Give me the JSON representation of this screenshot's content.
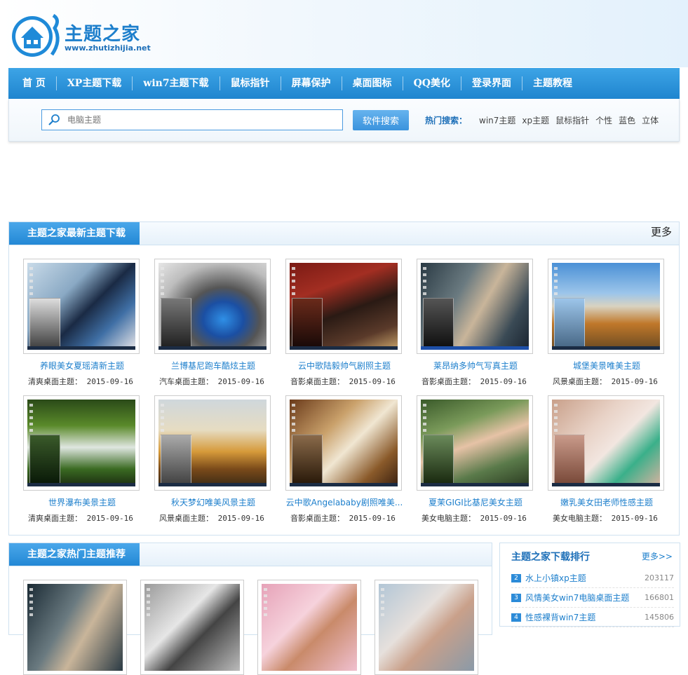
{
  "header": {
    "logo_title": "主题之家",
    "logo_url": "www.zhutizhijia.net"
  },
  "nav": [
    "首 页",
    "XP主题下载",
    "win7主题下载",
    "鼠标指针",
    "屏幕保护",
    "桌面图标",
    "QQ美化",
    "登录界面",
    "主题教程"
  ],
  "search": {
    "placeholder": "电脑主题",
    "button": "软件搜索",
    "hot_label": "热门搜索：",
    "hot_links": [
      "win7主题",
      "xp主题",
      "鼠标指针",
      "个性",
      "蓝色",
      "立体"
    ]
  },
  "latest": {
    "title": "主题之家最新主题下载",
    "more": "更多",
    "items": [
      {
        "title": "养眼美女夏瑶清新主题",
        "category": "清爽桌面主题：",
        "date": "2015-09-16"
      },
      {
        "title": "兰博基尼跑车酷炫主题",
        "category": "汽车桌面主题：",
        "date": "2015-09-16"
      },
      {
        "title": "云中歌陆毅帅气剧照主题",
        "category": "音影桌面主题：",
        "date": "2015-09-16"
      },
      {
        "title": "莱昂纳多帅气写真主题",
        "category": "音影桌面主题：",
        "date": "2015-09-16"
      },
      {
        "title": "城堡美景唯美主题",
        "category": "风景桌面主题：",
        "date": "2015-09-16"
      },
      {
        "title": "世界瀑布美景主题",
        "category": "清爽桌面主题：",
        "date": "2015-09-16"
      },
      {
        "title": "秋天梦幻唯美风景主题",
        "category": "风景桌面主题：",
        "date": "2015-09-16"
      },
      {
        "title": "云中歌Angelababy剧照唯美...",
        "category": "音影桌面主题：",
        "date": "2015-09-16"
      },
      {
        "title": "夏茉GIGI比基尼美女主题",
        "category": "美女电脑主题：",
        "date": "2015-09-16"
      },
      {
        "title": "嫩乳美女田老师性感主题",
        "category": "美女电脑主题：",
        "date": "2015-09-16"
      }
    ]
  },
  "hot": {
    "title": "主题之家热门主题推荐"
  },
  "ranking": {
    "title": "主题之家下载排行",
    "more": "更多>>",
    "items": [
      {
        "num": "2",
        "name": "水上小镇xp主题",
        "count": "203117"
      },
      {
        "num": "3",
        "name": "风情美女win7电脑桌面主题",
        "count": "166801"
      },
      {
        "num": "4",
        "name": "性感裸背win7主题",
        "count": "145806"
      }
    ]
  },
  "colors": {
    "brand_blue": "#1f85cf",
    "link_blue": "#1d7fcc"
  }
}
